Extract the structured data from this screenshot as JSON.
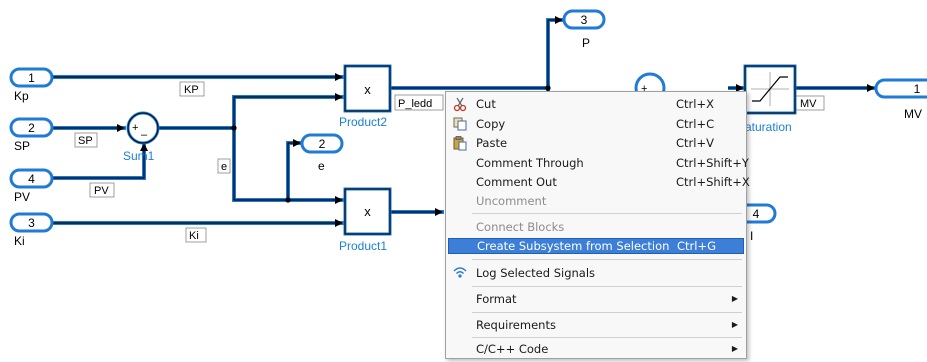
{
  "diagram": {
    "inports": [
      {
        "num": "1",
        "name": "Kp"
      },
      {
        "num": "2",
        "name": "SP"
      },
      {
        "num": "4",
        "name": "PV"
      },
      {
        "num": "3",
        "name": "Ki"
      }
    ],
    "outports": [
      {
        "num": "3",
        "name": "P"
      },
      {
        "num": "2",
        "name": "e"
      },
      {
        "num": "1",
        "name": "MV"
      },
      {
        "num": "4",
        "name": ""
      }
    ],
    "blocks": {
      "sum1": {
        "name": "Sum1",
        "plus": "+",
        "minus": "–"
      },
      "sum2": {
        "plus": "+"
      },
      "product2": {
        "name": "Product2",
        "symbol": "x"
      },
      "product1": {
        "name": "Product1",
        "symbol": "x"
      },
      "saturation": {
        "name": "aturation"
      }
    },
    "signal_labels": {
      "kp": "KP",
      "sp": "SP",
      "pv": "PV",
      "e": "e",
      "ki": "Ki",
      "p_ledd": "P_ledd",
      "mv": "MV",
      "partial": "I"
    },
    "colors": {
      "wire": "#1f7bd6",
      "block_name": "#1a7fd6",
      "selection": "#3d7fd6"
    }
  },
  "context_menu": {
    "cut": {
      "label": "Cut",
      "shortcut": "Ctrl+X",
      "icon": "scissors-icon"
    },
    "copy": {
      "label": "Copy",
      "shortcut": "Ctrl+C",
      "icon": "copy-icon"
    },
    "paste": {
      "label": "Paste",
      "shortcut": "Ctrl+V",
      "icon": "paste-icon"
    },
    "comment_through": {
      "label": "Comment Through",
      "shortcut": "Ctrl+Shift+Y"
    },
    "comment_out": {
      "label": "Comment Out",
      "shortcut": "Ctrl+Shift+X"
    },
    "uncomment": {
      "label": "Uncomment"
    },
    "connect_blocks": {
      "label": "Connect Blocks"
    },
    "create_subsystem": {
      "label": "Create Subsystem from Selection",
      "shortcut": "Ctrl+G"
    },
    "log_signals": {
      "label": "Log Selected Signals",
      "icon": "signal-logging-icon"
    },
    "format": {
      "label": "Format",
      "submenu": "▶"
    },
    "requirements": {
      "label": "Requirements",
      "submenu": "▶"
    },
    "code": {
      "label": "C/C++ Code",
      "submenu": "▶"
    }
  }
}
